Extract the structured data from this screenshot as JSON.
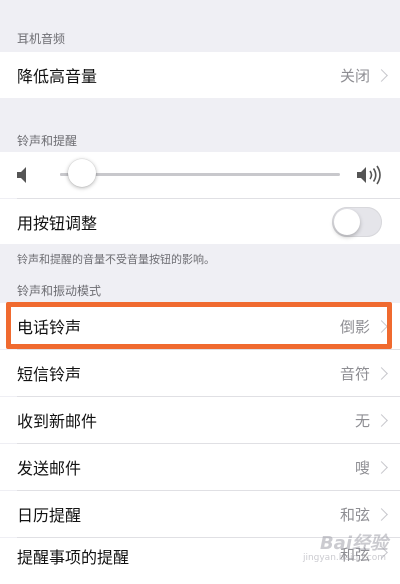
{
  "sections": {
    "headphone_audio": {
      "header": "耳机音频",
      "rows": [
        {
          "label": "降低高音量",
          "value": "关闭"
        }
      ]
    },
    "ringer_alerts": {
      "header": "铃声和提醒",
      "slider": {
        "level": 0.08,
        "low_icon": "speaker-low-icon",
        "high_icon": "speaker-high-icon"
      },
      "toggle_row": {
        "label": "用按钮调整",
        "on": false
      },
      "footer": "铃声和提醒的音量不受音量按钮的影响。"
    },
    "sounds_vibration": {
      "header": "铃声和振动模式",
      "rows": [
        {
          "label": "电话铃声",
          "value": "倒影"
        },
        {
          "label": "短信铃声",
          "value": "音符"
        },
        {
          "label": "收到新邮件",
          "value": "无"
        },
        {
          "label": "发送邮件",
          "value": "嗖"
        },
        {
          "label": "日历提醒",
          "value": "和弦"
        },
        {
          "label": "提醒事项的提醒",
          "value": "和弦"
        }
      ]
    }
  },
  "highlight_color": "#f06a2f",
  "watermark": {
    "text": "Bai经验",
    "sub": "jingyan.baidu.com"
  }
}
